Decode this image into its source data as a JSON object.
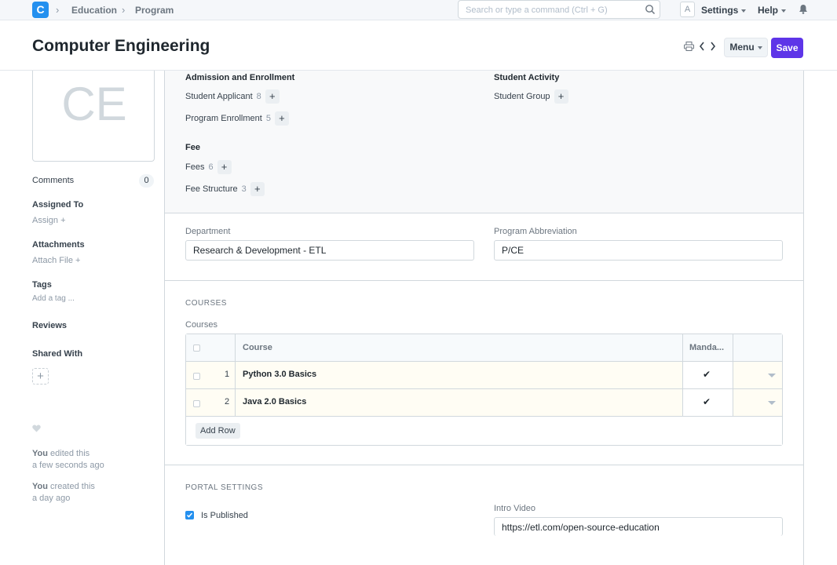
{
  "navbar": {
    "logo_letter": "C",
    "breadcrumbs": [
      "Education",
      "Program"
    ],
    "search_placeholder": "Search or type a command (Ctrl + G)",
    "avatar_letter": "A",
    "settings_label": "Settings",
    "help_label": "Help"
  },
  "header": {
    "title": "Computer Engineering",
    "menu_label": "Menu",
    "save_label": "Save"
  },
  "sidebar": {
    "image_initials": "CE",
    "comments_label": "Comments",
    "comments_count": "0",
    "assigned_to_label": "Assigned To",
    "assign_link": "Assign",
    "attachments_label": "Attachments",
    "attach_link": "Attach File",
    "tags_label": "Tags",
    "tags_placeholder": "Add a tag ...",
    "reviews_label": "Reviews",
    "shared_with_label": "Shared With",
    "timeline": [
      {
        "who": "You",
        "action": "edited this",
        "when": "a few seconds ago"
      },
      {
        "who": "You",
        "action": "created this",
        "when": "a day ago"
      }
    ]
  },
  "dashboard": {
    "groups": [
      {
        "title": "Admission and Enrollment",
        "links": [
          {
            "label": "Student Applicant",
            "count": "8"
          },
          {
            "label": "Program Enrollment",
            "count": "5"
          }
        ]
      },
      {
        "title": "Student Activity",
        "links": [
          {
            "label": "Student Group",
            "count": ""
          }
        ]
      },
      {
        "title": "Fee",
        "links": [
          {
            "label": "Fees",
            "count": "6"
          },
          {
            "label": "Fee Structure",
            "count": "3"
          }
        ]
      }
    ]
  },
  "fields": {
    "department_label": "Department",
    "department_value": "Research & Development - ETL",
    "abbr_label": "Program Abbreviation",
    "abbr_value": "P/CE"
  },
  "courses": {
    "section_title": "COURSES",
    "table_label": "Courses",
    "columns": [
      "Course",
      "Manda..."
    ],
    "rows": [
      {
        "idx": "1",
        "course": "Python 3.0 Basics",
        "mandatory": "✔"
      },
      {
        "idx": "2",
        "course": "Java 2.0 Basics",
        "mandatory": "✔"
      }
    ],
    "add_row_label": "Add Row"
  },
  "portal": {
    "section_title": "PORTAL SETTINGS",
    "is_published_label": "Is Published",
    "intro_video_label": "Intro Video",
    "intro_video_value": "https://etl.com/open-source-education"
  },
  "colors": {
    "primary": "#5e35e8",
    "logo": "#2490ef",
    "row_highlight": "#fffdf4"
  }
}
